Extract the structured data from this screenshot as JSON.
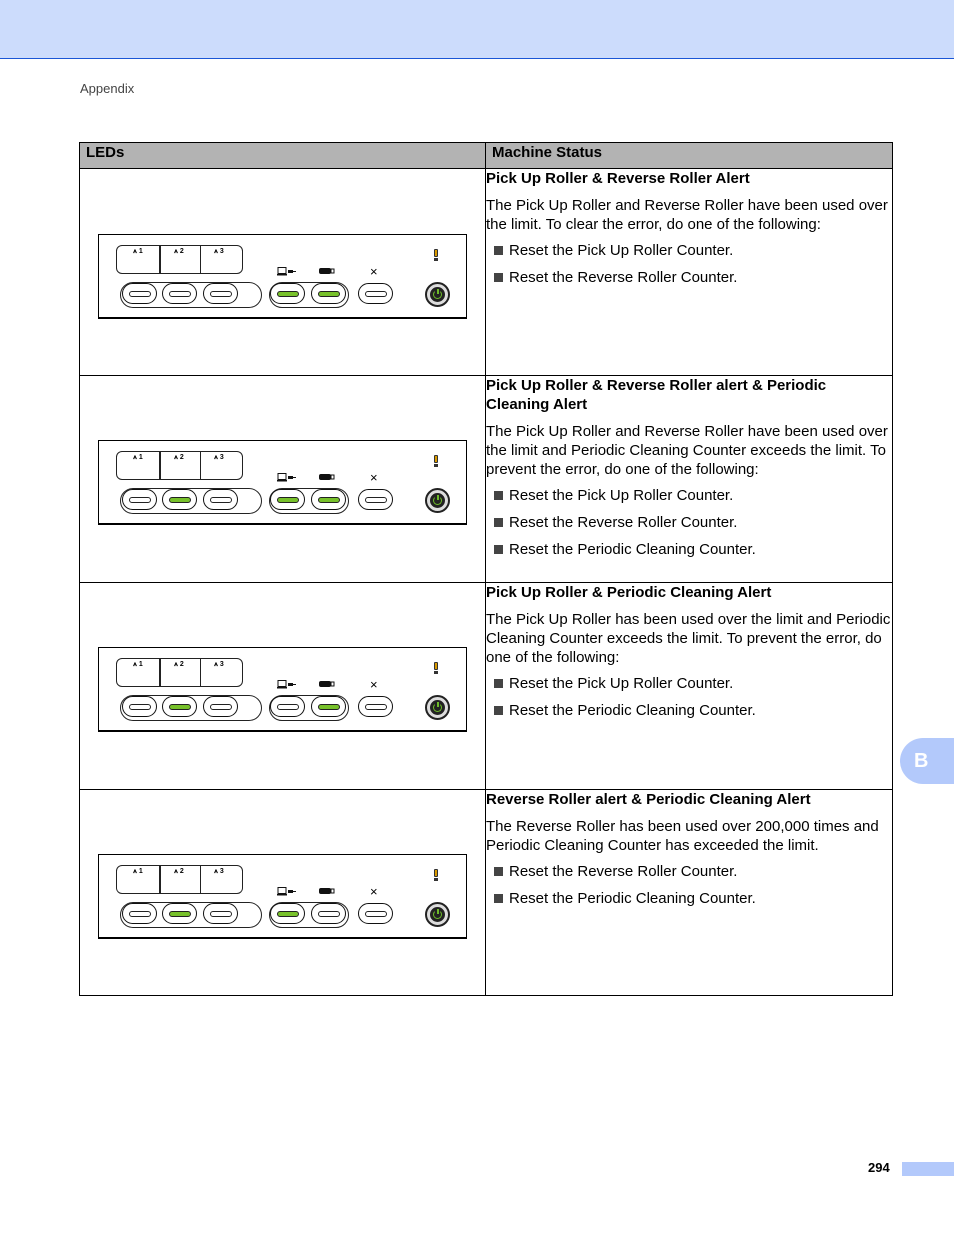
{
  "header": {
    "section": "Appendix"
  },
  "table": {
    "columns": [
      "LEDs",
      "Machine Status"
    ],
    "panel_labels": {
      "net1": "1",
      "net2": "2",
      "net3": "3",
      "cancel_symbol": "×"
    },
    "rows": [
      {
        "leds": {
          "btn1": false,
          "btn2": false,
          "btn3": false,
          "pc": true,
          "usb": true,
          "cancel": false
        },
        "title": "Pick Up Roller & Reverse Roller Alert",
        "description": "The Pick Up Roller and Reverse Roller have been used over the limit. To clear the error, do one of the following:",
        "actions": [
          "Reset the Pick Up Roller Counter.",
          "Reset the Reverse Roller Counter."
        ]
      },
      {
        "leds": {
          "btn1": false,
          "btn2": true,
          "btn3": false,
          "pc": true,
          "usb": true,
          "cancel": false
        },
        "title": "Pick Up Roller & Reverse Roller alert & Periodic Cleaning Alert",
        "description": "The Pick Up Roller and Reverse Roller have been used over the limit and Periodic Cleaning Counter exceeds the limit. To prevent the error, do one of the following:",
        "actions": [
          "Reset the Pick Up Roller Counter.",
          "Reset the Reverse Roller Counter.",
          "Reset the Periodic Cleaning Counter."
        ]
      },
      {
        "leds": {
          "btn1": false,
          "btn2": true,
          "btn3": false,
          "pc": false,
          "usb": true,
          "cancel": false
        },
        "title": "Pick Up Roller & Periodic Cleaning Alert",
        "description": "The Pick Up Roller has been used over the limit and Periodic Cleaning Counter exceeds the limit. To prevent the error, do one of the following:",
        "actions": [
          "Reset the Pick Up Roller Counter.",
          "Reset the Periodic Cleaning Counter."
        ]
      },
      {
        "leds": {
          "btn1": false,
          "btn2": true,
          "btn3": false,
          "pc": true,
          "usb": false,
          "cancel": false
        },
        "title": "Reverse Roller alert & Periodic Cleaning Alert",
        "description": "The Reverse Roller has been used over 200,000 times and Periodic Cleaning Counter has exceeded the limit.",
        "actions": [
          "Reset the Reverse Roller Counter.",
          "Reset the Periodic Cleaning Counter."
        ]
      }
    ]
  },
  "chapter_tab": "B",
  "footer": {
    "page_number": "294"
  },
  "colors": {
    "header_band": "#ccdcfc",
    "led_on": "#77c12a",
    "tab": "#b3c9fb",
    "table_header": "#b3b3b3"
  }
}
